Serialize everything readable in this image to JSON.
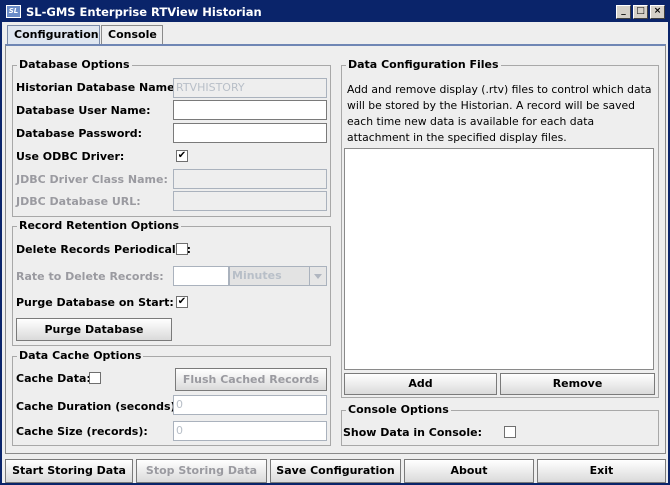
{
  "window": {
    "title": "SL-GMS Enterprise RTView Historian",
    "app_icon": "SL",
    "controls": [
      "_",
      "□",
      "×"
    ]
  },
  "tabs": [
    {
      "label": "Configuration",
      "active": true
    },
    {
      "label": "Console",
      "active": false
    }
  ],
  "database_options": {
    "title": "Database Options",
    "historian_db_name_label": "Historian Database Name:",
    "historian_db_name_value": "RTVHISTORY",
    "user_name_label": "Database User Name:",
    "user_name_value": "",
    "password_label": "Database Password:",
    "password_value": "",
    "use_odbc_label": "Use ODBC Driver:",
    "use_odbc_checked": "✔",
    "jdbc_driver_label": "JDBC Driver Class Name:",
    "jdbc_driver_value": "",
    "jdbc_url_label": "JDBC Database URL:",
    "jdbc_url_value": ""
  },
  "record_retention": {
    "title": "Record Retention Options",
    "delete_periodically_label": "Delete Records Periodically:",
    "delete_periodically_checked": "",
    "rate_label": "Rate to Delete Records:",
    "rate_value": "",
    "rate_unit": "Minutes",
    "purge_on_start_label": "Purge Database on Start:",
    "purge_on_start_checked": "✔",
    "purge_button": "Purge Database"
  },
  "data_cache": {
    "title": "Data Cache Options",
    "cache_data_label": "Cache Data:",
    "cache_data_checked": "",
    "flush_button": "Flush Cached Records",
    "duration_label": "Cache Duration (seconds):",
    "duration_value": "0",
    "size_label": "Cache Size (records):",
    "size_value": "0"
  },
  "data_config_files": {
    "title": "Data Configuration Files",
    "description": "Add and remove display (.rtv) files to control which data will be stored by the Historian. A record will be saved each time new data is available for each data attachment in the specified display files.",
    "add_button": "Add",
    "remove_button": "Remove"
  },
  "console_options": {
    "title": "Console Options",
    "show_data_label": "Show Data in Console:",
    "show_data_checked": ""
  },
  "footer": {
    "start": "Start Storing Data",
    "stop": "Stop Storing Data",
    "save": "Save Configuration",
    "about": "About",
    "exit": "Exit"
  },
  "colors": {
    "titlebar": "#0a246a",
    "accent": "#6f86b4"
  }
}
